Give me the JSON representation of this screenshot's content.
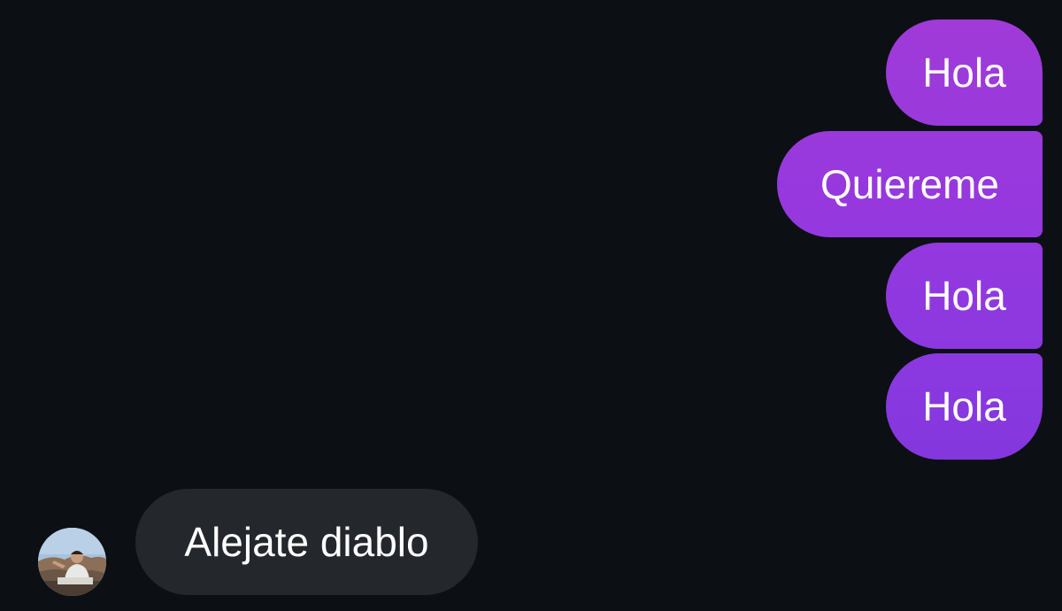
{
  "conversation": {
    "sent_messages": [
      {
        "text": "Hola"
      },
      {
        "text": "Quiereme"
      },
      {
        "text": "Hola"
      },
      {
        "text": "Hola"
      }
    ],
    "received_messages": [
      {
        "text": "Alejate diablo"
      }
    ]
  },
  "contact": {
    "avatar_icon": "profile-photo-avatar"
  },
  "colors": {
    "background": "#0c0f14",
    "sent_bubble": "#9338df",
    "received_bubble": "#24272c",
    "text": "#ffffff"
  }
}
